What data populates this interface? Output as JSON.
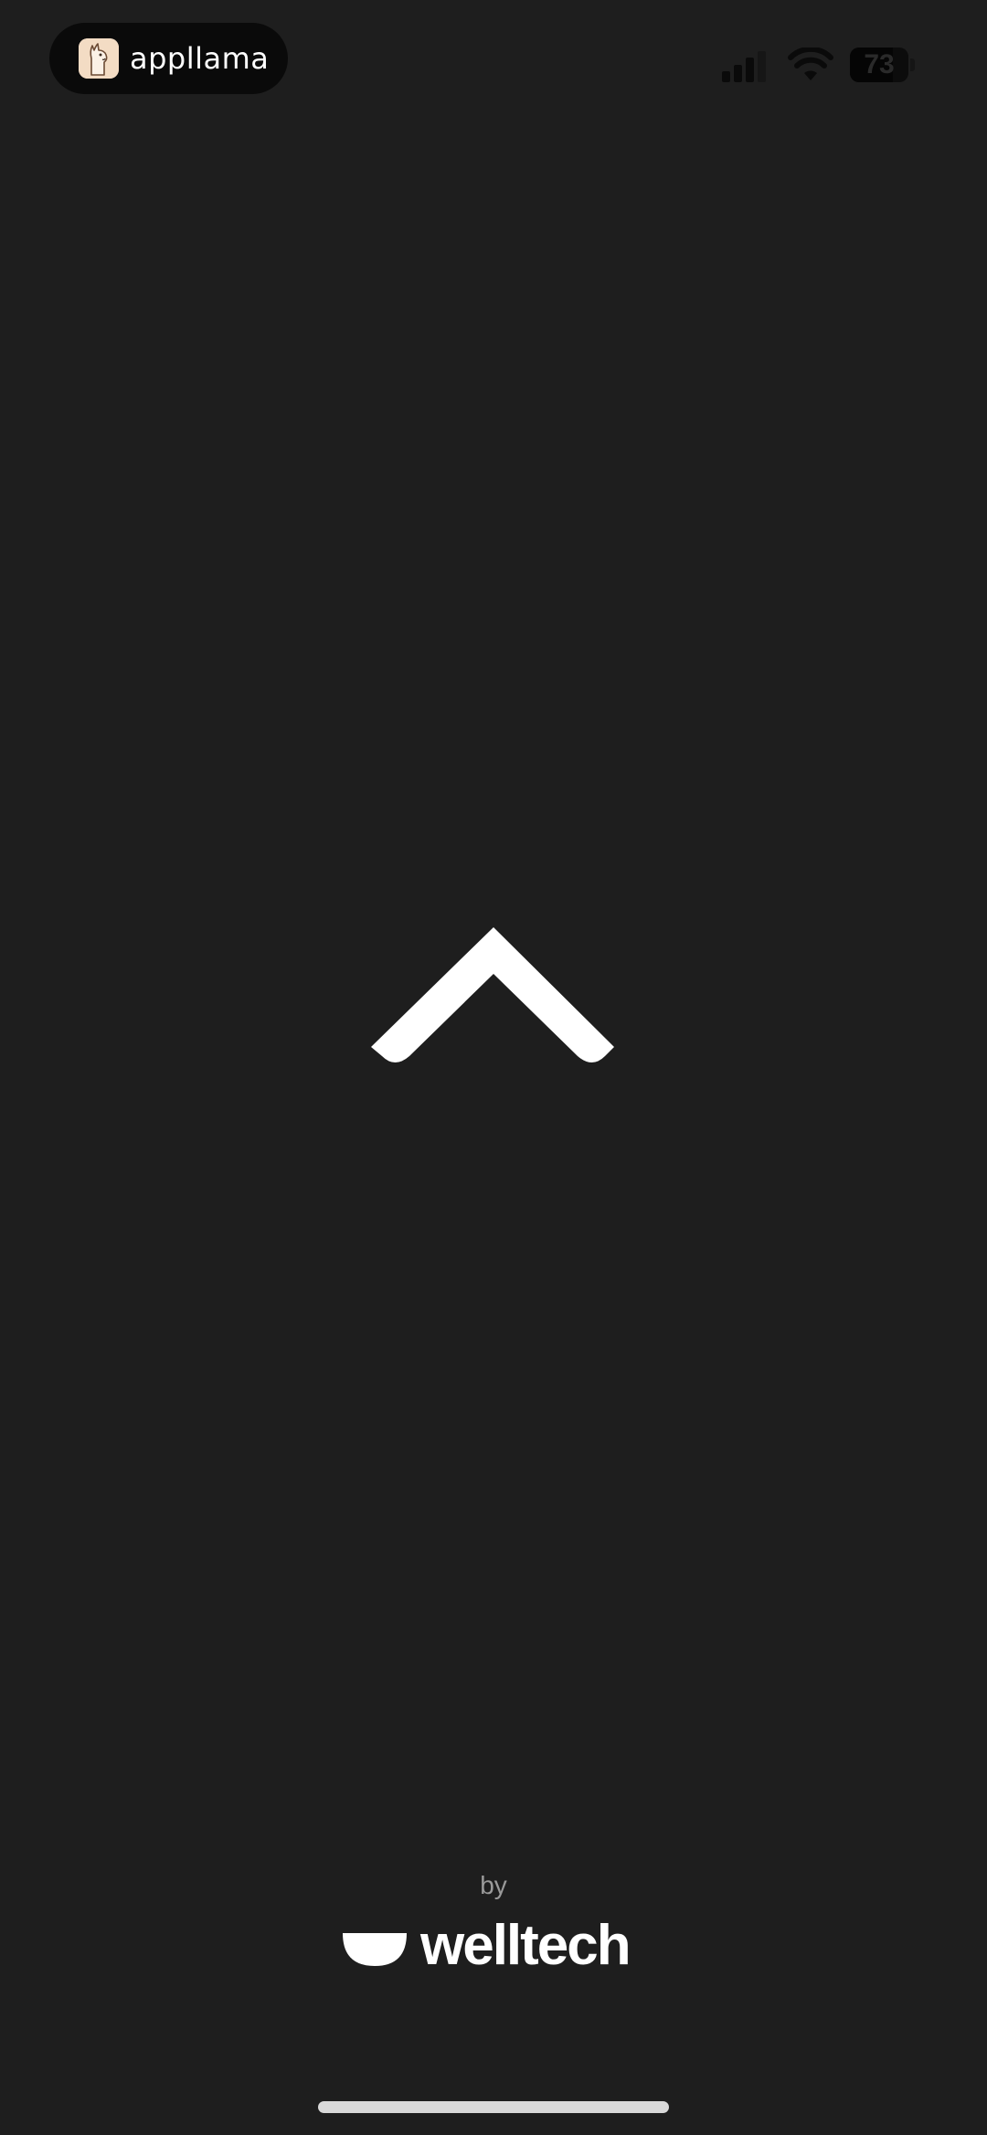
{
  "status_bar": {
    "app_badge": {
      "name": "appllama",
      "icon": "llama-icon"
    },
    "signal_icon": "signal-bars-icon",
    "wifi_icon": "wifi-icon",
    "battery": {
      "icon": "battery-icon",
      "percent_text": "73",
      "level": 0.73
    }
  },
  "main": {
    "chevron_icon": "chevron-up-icon"
  },
  "footer": {
    "by_label": "by",
    "brand": {
      "logo_icon": "welltech-bowl-icon",
      "name": "welltech"
    }
  },
  "colors": {
    "background": "#1e1e1e",
    "foreground": "#ffffff",
    "muted_text": "#9a9a9a",
    "home_indicator": "#d9d9d9"
  }
}
